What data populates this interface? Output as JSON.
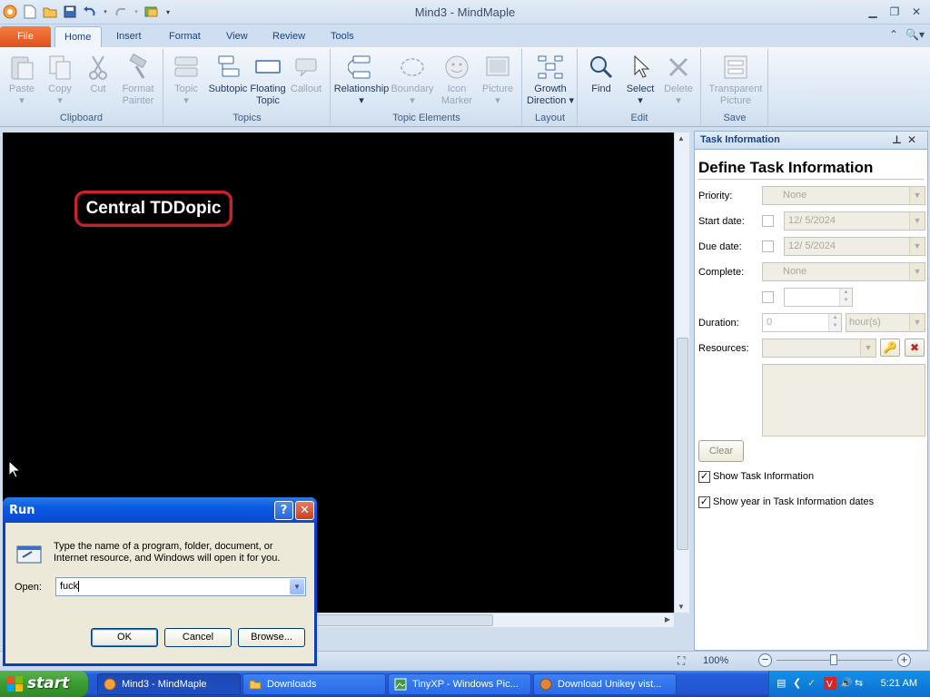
{
  "window": {
    "title": "Mind3 - MindMaple"
  },
  "tabs": [
    "File",
    "Home",
    "Insert",
    "Format",
    "View",
    "Review",
    "Tools"
  ],
  "ribbon": {
    "clipboard": {
      "name": "Clipboard",
      "paste": "Paste",
      "copy": "Copy",
      "cut": "Cut",
      "format_painter_1": "Format",
      "format_painter_2": "Painter"
    },
    "topics": {
      "name": "Topics",
      "topic": "Topic",
      "subtopic": "Subtopic",
      "floating_1": "Floating",
      "floating_2": "Topic",
      "callout": "Callout"
    },
    "topic_elements": {
      "name": "Topic Elements",
      "relationship": "Relationship",
      "boundary": "Boundary",
      "icon_marker_1": "Icon",
      "icon_marker_2": "Marker",
      "picture": "Picture"
    },
    "layout": {
      "name": "Layout",
      "growth_1": "Growth",
      "growth_2": "Direction"
    },
    "edit": {
      "name": "Edit",
      "find": "Find",
      "select": "Select",
      "delete": "Delete"
    },
    "save": {
      "name": "Save",
      "transparent_1": "Transparent",
      "transparent_2": "Picture"
    }
  },
  "canvas": {
    "central_topic": "Central TDDopic"
  },
  "task_panel": {
    "header": "Task Information",
    "title": "Define Task Information",
    "priority_label": "Priority:",
    "priority_value": "None",
    "start_label": "Start date:",
    "start_value": "12/ 5/2024",
    "due_label": "Due date:",
    "due_value": "12/ 5/2024",
    "complete_label": "Complete:",
    "complete_value": "None",
    "duration_label": "Duration:",
    "duration_value": "0",
    "duration_unit": "hour(s)",
    "resources_label": "Resources:",
    "clear": "Clear",
    "show_task_info": "Show Task Information",
    "show_year": "Show year in Task Information dates"
  },
  "status": {
    "zoom": "100%"
  },
  "run_dialog": {
    "title": "Run",
    "description": "Type the name of a program, folder, document, or Internet resource, and Windows will open it for you.",
    "open_label": "Open:",
    "open_value": "fuck",
    "ok": "OK",
    "cancel": "Cancel",
    "browse": "Browse..."
  },
  "taskbar": {
    "start": "start",
    "tasks": [
      "Mind3 - MindMaple",
      "Downloads",
      "TinyXP - Windows Pic...",
      "Download Unikey vist..."
    ],
    "clock": "5:21 AM"
  }
}
